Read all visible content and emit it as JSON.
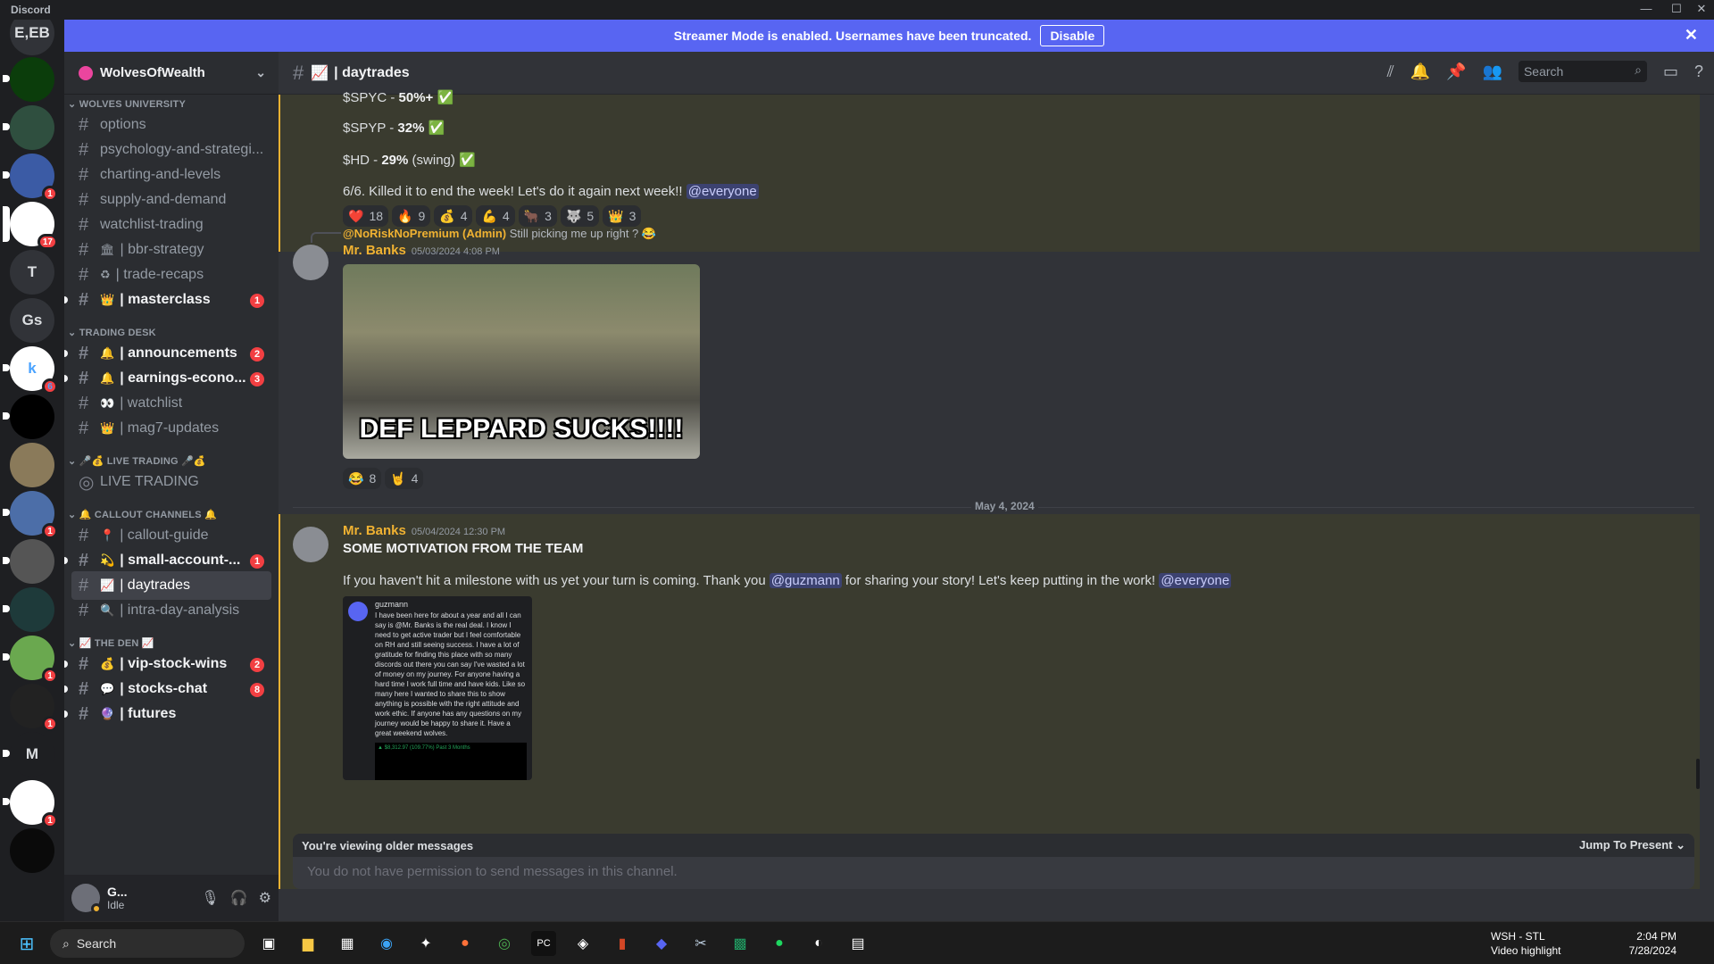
{
  "titlebar": {
    "app": "Discord",
    "minimize": "—",
    "maximize": "☐",
    "close": "✕"
  },
  "banner": {
    "text": "Streamer Mode is enabled. Usernames have been truncated.",
    "button": "Disable",
    "close": "✕"
  },
  "servers": [
    {
      "label": "E,EB",
      "color": "#313338",
      "badge": ""
    },
    {
      "label": "",
      "color": "#0b3d0b",
      "badge": ""
    },
    {
      "label": "",
      "color": "#2f4f3f",
      "badge": ""
    },
    {
      "label": "",
      "color": "#3b5ba5",
      "badge": "1"
    },
    {
      "label": "",
      "color": "#ffffff",
      "badge": "17"
    },
    {
      "label": "T",
      "color": "#313338",
      "badge": ""
    },
    {
      "label": "Gs",
      "color": "#313338",
      "badge": ""
    },
    {
      "label": "k",
      "color": "#ffffff",
      "badge": "6"
    },
    {
      "label": "",
      "color": "#000000",
      "badge": ""
    },
    {
      "label": "",
      "color": "#8a7a5a",
      "badge": ""
    },
    {
      "label": "",
      "color": "#4c6ea8",
      "badge": "1"
    },
    {
      "label": "",
      "color": "#555555",
      "badge": ""
    },
    {
      "label": "",
      "color": "#1e3a3a",
      "badge": ""
    },
    {
      "label": "",
      "color": "#6aa84f",
      "badge": "1"
    },
    {
      "label": "",
      "color": "#222222",
      "badge": "1"
    },
    {
      "label": "M",
      "color": "#1e1f22",
      "badge": ""
    },
    {
      "label": "",
      "color": "#ffffff",
      "badge": "1"
    },
    {
      "label": "",
      "color": "#0a0a0a",
      "badge": ""
    }
  ],
  "guild": {
    "name": "WolvesOfWealth"
  },
  "sidebar": {
    "cat1": "WOLVES UNIVERSITY",
    "cat2": "TRADING DESK",
    "cat3": "🎤💰 LIVE TRADING 🎤💰",
    "cat4": "🔔 CALLOUT CHANNELS 🔔",
    "cat5": "📈 THE DEN 📈",
    "channels": [
      {
        "name": "options",
        "emoji": "",
        "unread": false,
        "badge": ""
      },
      {
        "name": "psychology-and-strategi...",
        "emoji": "",
        "unread": false,
        "badge": ""
      },
      {
        "name": "charting-and-levels",
        "emoji": "",
        "unread": false,
        "badge": ""
      },
      {
        "name": "supply-and-demand",
        "emoji": "",
        "unread": false,
        "badge": ""
      },
      {
        "name": "watchlist-trading",
        "emoji": "",
        "unread": false,
        "badge": ""
      },
      {
        "name": "| bbr-strategy",
        "emoji": "🏛",
        "unread": false,
        "badge": ""
      },
      {
        "name": "| trade-recaps",
        "emoji": "♻",
        "unread": false,
        "badge": ""
      },
      {
        "name": "| masterclass",
        "emoji": "👑",
        "unread": true,
        "badge": "1"
      },
      {
        "name": "| announcements",
        "emoji": "🔔",
        "unread": true,
        "badge": "2"
      },
      {
        "name": "| earnings-econo...",
        "emoji": "🔔",
        "unread": true,
        "badge": "3"
      },
      {
        "name": "| watchlist",
        "emoji": "👀",
        "unread": false,
        "badge": ""
      },
      {
        "name": "| mag7-updates",
        "emoji": "👑",
        "unread": false,
        "badge": ""
      },
      {
        "name": "LIVE TRADING",
        "emoji": "",
        "unread": false,
        "badge": ""
      },
      {
        "name": "| callout-guide",
        "emoji": "📍",
        "unread": false,
        "badge": ""
      },
      {
        "name": "| small-account-...",
        "emoji": "💫",
        "unread": true,
        "badge": "1"
      },
      {
        "name": "| daytrades",
        "emoji": "📈",
        "unread": false,
        "badge": ""
      },
      {
        "name": "| intra-day-analysis",
        "emoji": "🔍",
        "unread": false,
        "badge": ""
      },
      {
        "name": "| vip-stock-wins",
        "emoji": "💰",
        "unread": true,
        "badge": "2"
      },
      {
        "name": "| stocks-chat",
        "emoji": "💬",
        "unread": true,
        "badge": "8"
      },
      {
        "name": "| futures",
        "emoji": "🔮",
        "unread": true,
        "badge": ""
      }
    ]
  },
  "user": {
    "name": "G...",
    "status": "Idle"
  },
  "header": {
    "channel": "| daytrades",
    "search_placeholder": "Search"
  },
  "messages": {
    "l1": "$SPYC - ",
    "l1b": "50%+",
    "l1e": " ✅",
    "l2": "$SPYP - ",
    "l2b": "32%",
    "l2e": " ✅",
    "l3": "$HD - ",
    "l3b": "29%",
    "l3e": " (swing) ✅",
    "l4": "6/6. Killed it to end the week! Let's do it again next week!! ",
    "l4m": "@everyone",
    "reactions1": [
      {
        "emoji": "❤️",
        "count": "18"
      },
      {
        "emoji": "🔥",
        "count": "9"
      },
      {
        "emoji": "💰",
        "count": "4"
      },
      {
        "emoji": "💪",
        "count": "4"
      },
      {
        "emoji": "🐂",
        "count": "3"
      },
      {
        "emoji": "🐺",
        "count": "5"
      },
      {
        "emoji": "👑",
        "count": "3"
      }
    ],
    "reply_name": "@NoRiskNoPremium (Admin)",
    "reply_text": "Still picking me up right ? 😂",
    "m2_author": "Mr. Banks",
    "m2_time": "05/03/2024 4:08 PM",
    "gif_caption": "DEF LEPPARD SUCKS!!!!",
    "reactions2": [
      {
        "emoji": "😂",
        "count": "8"
      },
      {
        "emoji": "🤘",
        "count": "4"
      }
    ],
    "date_divider": "May 4, 2024",
    "m3_author": "Mr. Banks",
    "m3_time": "05/04/2024 12:30 PM",
    "m3_title": "SOME MOTIVATION FROM THE TEAM",
    "m3_text1": "If you haven't hit a milestone with us yet your turn is coming. Thank you ",
    "m3_mention1": "@guzmann",
    "m3_text2": " for sharing your story! Let's keep putting in the work! ",
    "m3_mention2": "@everyone",
    "shot_name": "guzmann",
    "shot_text": "I have been here for about a year and all I can say is @Mr. Banks is the real deal. I know I need to get active trader but I feel comfortable on RH and still seeing success. I have a lot of gratitude for finding this place with so many discords out there you can say I've wasted a lot of money on my journey. For anyone having a hard time I work full time and have kids. Like so many here I wanted to share this to show anything is possible with the right attitude and work ethic. If anyone has any questions on my journey would be happy to share it. Have a great weekend wolves.",
    "shot_chart": "▲ $8,312.97 (109.77%) Past 3 Months"
  },
  "footer": {
    "older": "You're viewing older messages",
    "jump": "Jump To Present ⌄",
    "composer": "You do not have permission to send messages in this channel."
  },
  "taskbar": {
    "search": "Search",
    "weather_title": "WSH - STL",
    "weather_sub": "Video highlight",
    "time": "2:04 PM",
    "date": "7/28/2024"
  }
}
